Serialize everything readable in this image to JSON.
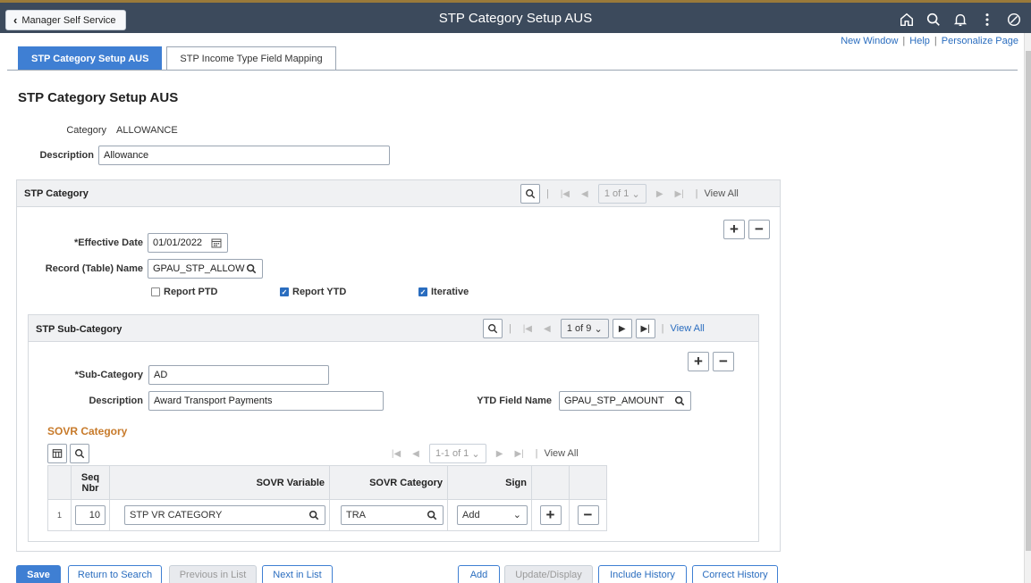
{
  "header": {
    "back_label": "Manager Self Service",
    "title": "STP Category Setup AUS"
  },
  "utility_links": {
    "new_window": "New Window",
    "help": "Help",
    "personalize": "Personalize Page",
    "sep": "|"
  },
  "tabs": [
    {
      "label": "STP Category Setup AUS",
      "active": true
    },
    {
      "label": "STP Income Type Field Mapping",
      "active": false
    }
  ],
  "page_title": "STP Category Setup AUS",
  "category": {
    "label": "Category",
    "value": "ALLOWANCE",
    "description_label": "Description",
    "description_value": "Allowance"
  },
  "stp_category": {
    "title": "STP Category",
    "pager": "1 of 1",
    "view_all": "View All",
    "effective_date_label": "*Effective Date",
    "effective_date_value": "01/01/2022",
    "record_label": "Record (Table) Name",
    "record_value": "GPAU_STP_ALLOW",
    "report_ptd_label": "Report PTD",
    "report_ptd_checked": false,
    "report_ytd_label": "Report YTD",
    "report_ytd_checked": true,
    "iterative_label": "Iterative",
    "iterative_checked": true
  },
  "stp_sub_category": {
    "title": "STP Sub-Category",
    "pager": "1 of 9",
    "view_all": "View All",
    "sub_category_label": "*Sub-Category",
    "sub_category_value": "AD",
    "description_label": "Description",
    "description_value": "Award Transport Payments",
    "ytd_field_label": "YTD Field Name",
    "ytd_field_value": "GPAU_STP_AMOUNT"
  },
  "sovr_category": {
    "title": "SOVR Category",
    "pager": "1-1 of 1",
    "view_all": "View All",
    "columns": {
      "seq_nbr": "Seq Nbr",
      "sovr_variable": "SOVR Variable",
      "sovr_category": "SOVR Category",
      "sign": "Sign"
    },
    "rows": [
      {
        "row_num": "1",
        "seq": "10",
        "variable": "STP VR CATEGORY",
        "category": "TRA",
        "sign": "Add"
      }
    ]
  },
  "toolbar": {
    "save": "Save",
    "return_to_search": "Return to Search",
    "previous_in_list": "Previous in List",
    "next_in_list": "Next in List",
    "add": "Add",
    "update_display": "Update/Display",
    "include_history": "Include History",
    "correct_history": "Correct History"
  },
  "icons": {
    "back": "chevron-left-icon",
    "home": "home-icon",
    "search": "search-icon",
    "notifications": "bell-icon",
    "actions": "more-vertical-icon",
    "navbar": "compass-icon",
    "calendar": "calendar-icon",
    "lookup": "search-icon",
    "grid_personalize": "grid-personalize-icon"
  },
  "colors": {
    "header_bg": "#3c4a5c",
    "accent": "#3f7fd3",
    "link": "#2a6dbf",
    "sovr_title": "#c77a2a"
  }
}
